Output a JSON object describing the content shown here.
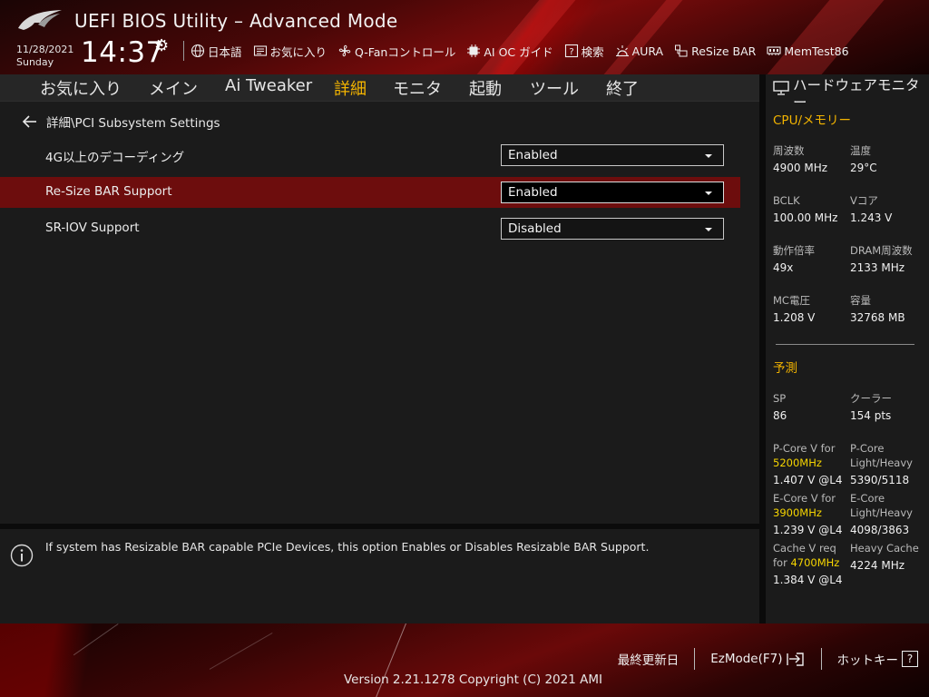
{
  "header": {
    "title": "UEFI BIOS Utility – Advanced Mode",
    "date": "11/28/2021",
    "day": "Sunday",
    "time": "14:37",
    "toolbar": [
      {
        "name": "language",
        "icon": "globe-icon",
        "label": "日本語"
      },
      {
        "name": "favorites",
        "icon": "favorites-icon",
        "label": "お気に入り"
      },
      {
        "name": "qfan",
        "icon": "fan-icon",
        "label": "Q-Fanコントロール"
      },
      {
        "name": "aioc",
        "icon": "ai-oc-icon",
        "label": "AI OC ガイド"
      },
      {
        "name": "search",
        "icon": "help-search-icon",
        "label": "検索"
      },
      {
        "name": "aura",
        "icon": "aura-icon",
        "label": "AURA"
      },
      {
        "name": "resizebar",
        "icon": "resize-bar-icon",
        "label": "ReSize BAR"
      },
      {
        "name": "memtest",
        "icon": "memory-icon",
        "label": "MemTest86"
      }
    ]
  },
  "nav": {
    "tabs": [
      {
        "label": "お気に入り",
        "active": false
      },
      {
        "label": "メイン",
        "active": false
      },
      {
        "label": "Ai Tweaker",
        "active": false
      },
      {
        "label": "詳細",
        "active": true
      },
      {
        "label": "モニタ",
        "active": false
      },
      {
        "label": "起動",
        "active": false
      },
      {
        "label": "ツール",
        "active": false
      },
      {
        "label": "終了",
        "active": false
      }
    ]
  },
  "main": {
    "breadcrumb": "詳細\\PCI Subsystem Settings",
    "settings": [
      {
        "label": "4G以上のデコーディング",
        "value": "Enabled",
        "selected": false
      },
      {
        "label": "Re-Size BAR Support",
        "value": "Enabled",
        "selected": true
      },
      {
        "label": "SR-IOV Support",
        "value": "Disabled",
        "selected": false
      }
    ]
  },
  "help": {
    "text": "If system has Resizable BAR capable PCIe Devices, this option Enables or Disables Resizable BAR Support."
  },
  "sidebar": {
    "title": "ハードウェアモニター",
    "cpu_section": "CPU/メモリー",
    "metrics": [
      {
        "label": "周波数",
        "value": "4900 MHz"
      },
      {
        "label": "温度",
        "value": "29°C"
      },
      {
        "label": "BCLK",
        "value": "100.00 MHz"
      },
      {
        "label": "Vコア",
        "value": "1.243 V"
      },
      {
        "label": "動作倍率",
        "value": "49x"
      },
      {
        "label": "DRAM周波数",
        "value": "2133 MHz"
      },
      {
        "label": "MC電圧",
        "value": "1.208 V"
      },
      {
        "label": "容量",
        "value": "32768 MB"
      }
    ],
    "prediction_section": "予測",
    "prediction": [
      {
        "label": "SP",
        "value": "86"
      },
      {
        "label": "クーラー",
        "value": "154 pts"
      }
    ],
    "pcore_v": {
      "label": "P-Core V for",
      "freq": "5200MHz",
      "value": "1.407 V @L4"
    },
    "pcore_lh": {
      "label1": "P-Core",
      "label2": "Light/Heavy",
      "value": "5390/5118"
    },
    "ecore_v": {
      "label": "E-Core V for",
      "freq": "3900MHz",
      "value": "1.239 V @L4"
    },
    "ecore_lh": {
      "label1": "E-Core",
      "label2": "Light/Heavy",
      "value": "4098/3863"
    },
    "cache_v": {
      "label1": "Cache V req",
      "label2": "for",
      "freq": "4700MHz",
      "value": "1.384 V @L4"
    },
    "heavy_cache": {
      "label": "Heavy Cache",
      "value": "4224 MHz"
    },
    "highlight_color": "#f5d400"
  },
  "footer": {
    "last_modified": "最終更新日",
    "ezmode": "EzMode(F7)",
    "hotkeys": "ホットキー",
    "hotkeys_symbol": "?",
    "version": "Version 2.21.1278 Copyright (C) 2021 AMI"
  },
  "colors": {
    "accent": "#f2b300",
    "selected_row": "#6d0d0d",
    "panel": "#1b1b1b"
  }
}
